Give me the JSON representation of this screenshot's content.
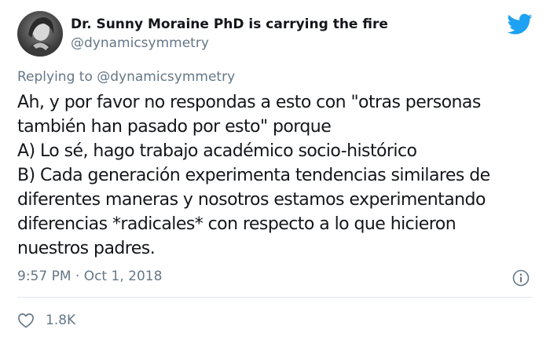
{
  "tweet": {
    "display_name": "Dr. Sunny Moraine PhD is carrying the fire",
    "handle": "@dynamicsymmetry",
    "reply_to": "Replying to @dynamicsymmetry",
    "text_lines": [
      "Ah, y por favor no respondas a esto con \"otras personas",
      "también han pasado por esto\" porque",
      "A) Lo sé, hago trabajo académico socio-histórico",
      "B) Cada generación experimenta tendencias similares de",
      "diferentes maneras y nosotros estamos experimentando",
      "diferencias *radicales* con respecto a lo que hicieron",
      "nuestros padres."
    ],
    "timestamp": "9:57 PM · Oct 1, 2018",
    "like_count": "1.8K"
  },
  "icons": {
    "brand": "twitter-bird-icon",
    "info": "info-icon",
    "like": "heart-icon"
  },
  "colors": {
    "brand_blue": "#1da1f2",
    "text_primary": "#14171a",
    "text_secondary": "#657786",
    "divider": "#e1e8ed"
  }
}
